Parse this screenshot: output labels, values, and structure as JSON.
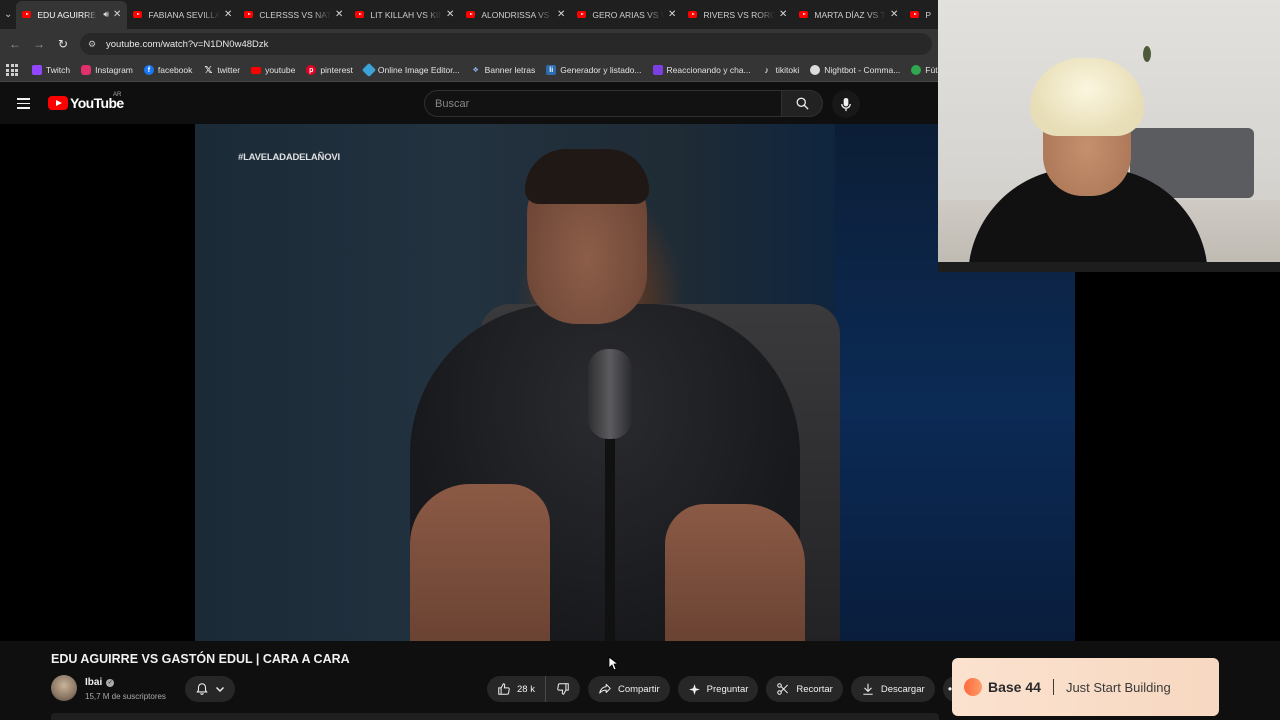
{
  "browser": {
    "tabs": [
      {
        "label": "EDU AGUIRRE",
        "active": true,
        "audio": true
      },
      {
        "label": "FABIANA SEVILLA"
      },
      {
        "label": "CLERSSS VS NATA"
      },
      {
        "label": "LIT KILLAH VS KIN"
      },
      {
        "label": "ALONDRISSA VS"
      },
      {
        "label": "GERO ARIAS VS V"
      },
      {
        "label": "RIVERS VS RORO"
      },
      {
        "label": "MARTA DÍAZ VS T"
      },
      {
        "label": "P"
      }
    ],
    "url": "youtube.com/watch?v=N1DN0w48Dzk",
    "bookmarks": [
      {
        "label": "Twitch",
        "icon": "twitch-icon",
        "color": "#9146ff"
      },
      {
        "label": "Instagram",
        "icon": "instagram-icon",
        "color": "#e1306c"
      },
      {
        "label": "facebook",
        "icon": "facebook-icon",
        "color": "#1877f2"
      },
      {
        "label": "twitter",
        "icon": "x-icon",
        "color": "#000000"
      },
      {
        "label": "youtube",
        "icon": "youtube-icon",
        "color": "#ff0000"
      },
      {
        "label": "pinterest",
        "icon": "pinterest-icon",
        "color": "#e60023"
      },
      {
        "label": "Online Image Editor...",
        "icon": "image-editor-icon",
        "color": "#3ba3d8"
      },
      {
        "label": "Banner letras",
        "icon": "banner-icon",
        "color": "#5b7fd6"
      },
      {
        "label": "Generador y listado...",
        "icon": "generator-icon",
        "color": "#2b6cb0"
      },
      {
        "label": "Reaccionando y cha...",
        "icon": "reaction-icon",
        "color": "#7b3fe4"
      },
      {
        "label": "tikitoki",
        "icon": "tiktok-icon",
        "color": "#111111"
      },
      {
        "label": "Nightbot - Comma...",
        "icon": "nightbot-icon",
        "color": "#444444"
      },
      {
        "label": "Fútbol",
        "icon": "football-icon",
        "color": "#2fa84f"
      }
    ]
  },
  "youtube": {
    "logo_text": "YouTube",
    "country_code": "AR",
    "search_placeholder": "Buscar"
  },
  "video": {
    "overlay_tag": "#LAVELADADELAÑOVI",
    "title": "EDU AGUIRRE VS GASTÓN EDUL | CARA A CARA",
    "channel": "Ibai",
    "subscribers": "15,7 M de suscriptores",
    "likes": "28 k",
    "actions": {
      "share": "Compartir",
      "ask": "Preguntar",
      "clip": "Recortar",
      "download": "Descargar"
    }
  },
  "ad": {
    "brand": "Base 44",
    "tagline": "Just Start Building"
  },
  "colors": {
    "youtube_red": "#ff0000",
    "background": "#0f0f0f",
    "pill": "#272727"
  }
}
